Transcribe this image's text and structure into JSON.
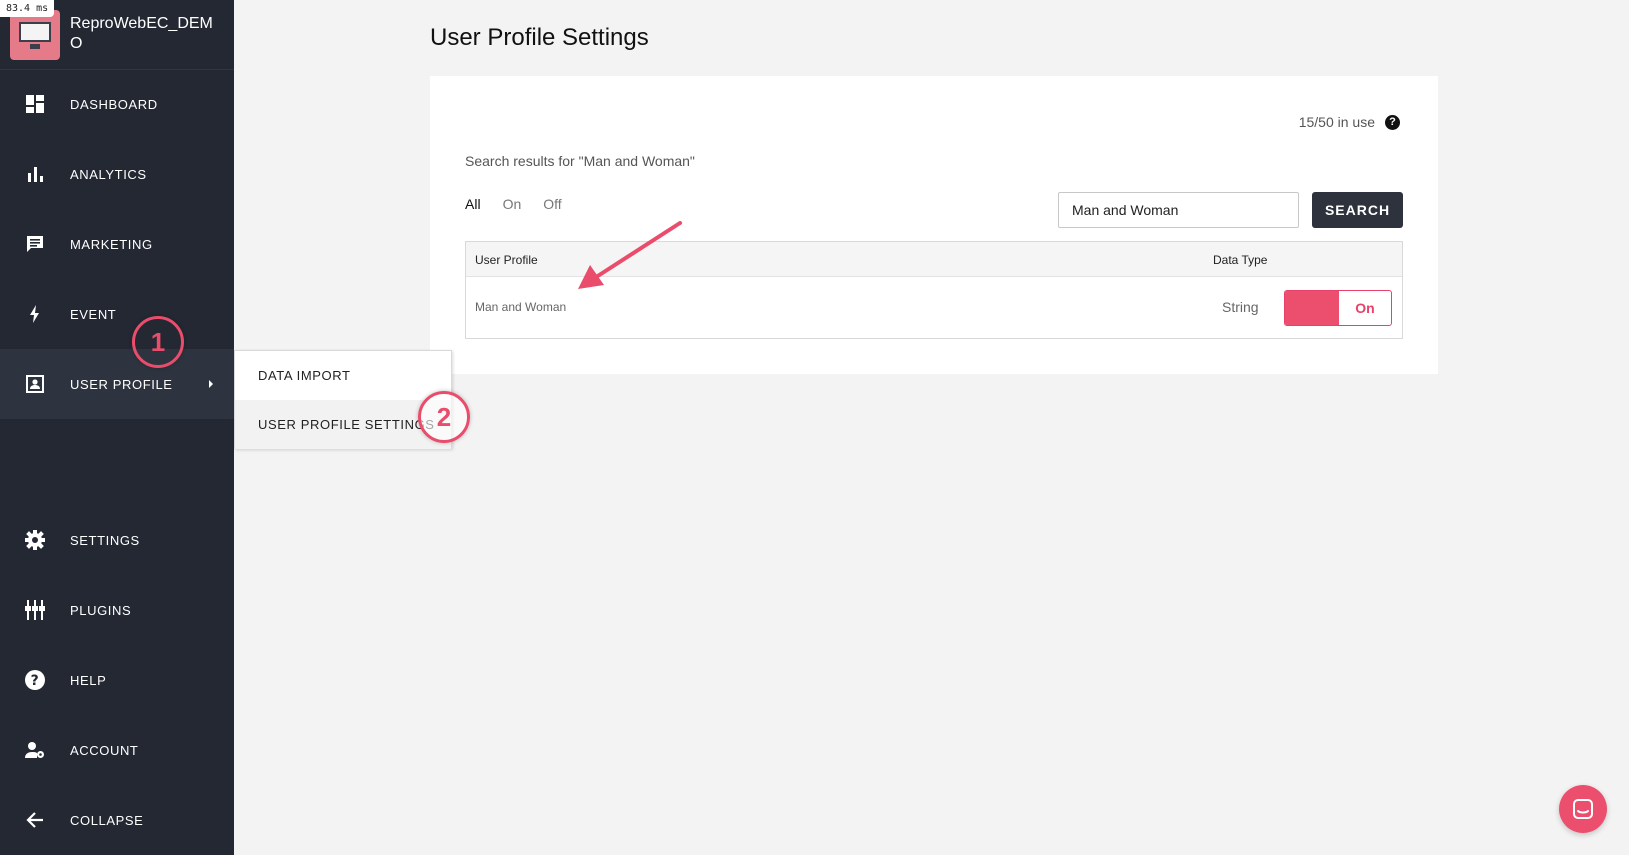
{
  "timing": "83.4 ms",
  "brand": {
    "name": "ReproWebEC_DEMO"
  },
  "sidebar": {
    "items": [
      {
        "label": "DASHBOARD",
        "icon": "dashboard-icon"
      },
      {
        "label": "ANALYTICS",
        "icon": "bar-chart-icon"
      },
      {
        "label": "MARKETING",
        "icon": "message-icon"
      },
      {
        "label": "EVENT",
        "icon": "bolt-icon"
      },
      {
        "label": "USER PROFILE",
        "icon": "profile-card-icon"
      },
      {
        "label": "SETTINGS",
        "icon": "gear-icon"
      },
      {
        "label": "PLUGINS",
        "icon": "plugins-icon"
      },
      {
        "label": "HELP",
        "icon": "help-icon"
      },
      {
        "label": "ACCOUNT",
        "icon": "account-settings-icon"
      },
      {
        "label": "COLLAPSE",
        "icon": "arrow-left-icon"
      }
    ]
  },
  "submenu": {
    "items": [
      {
        "label": "DATA IMPORT"
      },
      {
        "label": "USER PROFILE SETTINGS"
      }
    ]
  },
  "page": {
    "title": "User Profile Settings"
  },
  "card": {
    "usage": "15/50 in use",
    "search_results": "Search results for \"Man and Woman\"",
    "filters": [
      "All",
      "On",
      "Off"
    ],
    "search": {
      "value": "Man and Woman",
      "button": "SEARCH"
    },
    "table": {
      "headers": {
        "profile": "User Profile",
        "type": "Data Type"
      },
      "rows": [
        {
          "profile": "Man and Woman",
          "type": "String",
          "toggle": "On"
        }
      ]
    }
  },
  "annotations": {
    "step1": "1",
    "step2": "2"
  },
  "colors": {
    "sidebar": "#232833",
    "accent": "#ec4f6d",
    "button_dark": "#2d323c"
  }
}
